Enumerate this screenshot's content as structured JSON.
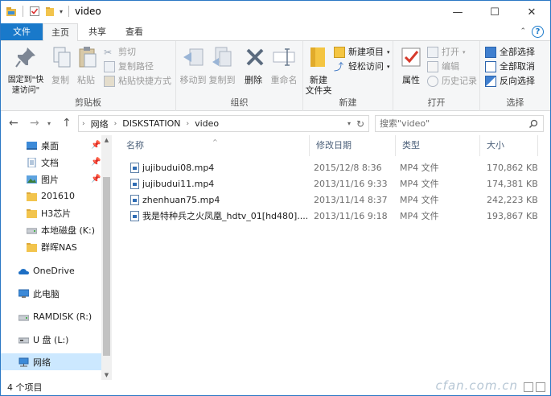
{
  "window": {
    "title": "video",
    "minimize": "—",
    "maximize": "☐",
    "close": "✕"
  },
  "tabs": {
    "file": "文件",
    "home": "主页",
    "share": "共享",
    "view": "查看",
    "help": "?"
  },
  "ribbon": {
    "clipboard": {
      "label": "剪贴板",
      "pin": "固定到\"快速访问\"",
      "copy": "复制",
      "paste": "粘贴",
      "cut": "剪切",
      "copy_path": "复制路径",
      "paste_shortcut": "粘贴快捷方式"
    },
    "organize": {
      "label": "组织",
      "move_to": "移动到",
      "copy_to": "复制到",
      "delete": "删除",
      "rename": "重命名"
    },
    "new": {
      "label": "新建",
      "new_folder": "新建\n文件夹",
      "new_item": "新建项目",
      "easy_access": "轻松访问"
    },
    "open": {
      "label": "打开",
      "properties": "属性",
      "open": "打开",
      "edit": "编辑",
      "history": "历史记录"
    },
    "select": {
      "label": "选择",
      "select_all": "全部选择",
      "select_none": "全部取消",
      "invert": "反向选择"
    }
  },
  "address": {
    "crumbs": [
      "网络",
      "DISKSTATION",
      "video"
    ],
    "search_placeholder": "搜索\"video\""
  },
  "nav": {
    "items": [
      {
        "label": "桌面",
        "pinned": true
      },
      {
        "label": "文档",
        "pinned": true
      },
      {
        "label": "图片",
        "pinned": true
      },
      {
        "label": "201610",
        "pinned": false
      },
      {
        "label": "H3芯片",
        "pinned": false
      },
      {
        "label": "本地磁盘 (K:)",
        "pinned": false
      },
      {
        "label": "群晖NAS",
        "pinned": false
      },
      {
        "label": "OneDrive",
        "pinned": false
      },
      {
        "label": "此电脑",
        "pinned": false
      },
      {
        "label": "RAMDISK (R:)",
        "pinned": false
      },
      {
        "label": "U 盘 (L:)",
        "pinned": false
      },
      {
        "label": "网络",
        "pinned": false
      }
    ],
    "pin_glyph": "📌"
  },
  "filelist": {
    "columns": {
      "name": "名称",
      "date": "修改日期",
      "type": "类型",
      "size": "大小"
    },
    "rows": [
      {
        "name": "jujibudui08.mp4",
        "date": "2015/12/8 8:36",
        "type": "MP4 文件",
        "size": "170,862 KB"
      },
      {
        "name": "jujibudui11.mp4",
        "date": "2013/11/16 9:33",
        "type": "MP4 文件",
        "size": "174,381 KB"
      },
      {
        "name": "zhenhuan75.mp4",
        "date": "2013/11/14 8:37",
        "type": "MP4 文件",
        "size": "242,223 KB"
      },
      {
        "name": "我是特种兵之火凤凰_hdtv_01[hd480]....",
        "date": "2013/11/16 9:18",
        "type": "MP4 文件",
        "size": "193,867 KB"
      }
    ]
  },
  "status": {
    "count": "4 个项目"
  },
  "watermark": "cfan.com.cn",
  "colors": {
    "accent": "#1979ca",
    "selection": "#cce8ff"
  }
}
